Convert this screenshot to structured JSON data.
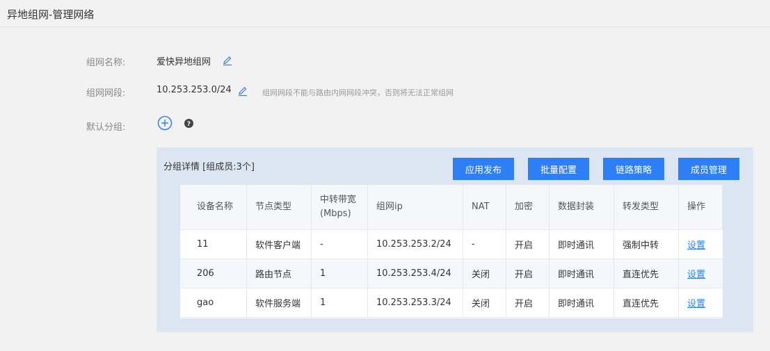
{
  "header": {
    "title": "异地组网-管理网络"
  },
  "form": {
    "name_label": "组网名称:",
    "name_value": "爱快异地组网",
    "segment_label": "组网网段:",
    "segment_value": "10.253.253.0/24",
    "segment_hint": "组网网段不能与路由内网网段冲突，否则将无法正常组网",
    "group_label": "默认分组:"
  },
  "panel": {
    "title": "分组详情 [组成员:3个]",
    "buttons": [
      "应用发布",
      "批量配置",
      "链路策略",
      "成员管理"
    ]
  },
  "table": {
    "headers": [
      "设备名称",
      "节点类型",
      "中转带宽",
      "(Mbps)",
      "组网ip",
      "NAT",
      "加密",
      "数据封装",
      "转发类型",
      "操作"
    ],
    "rows": [
      [
        "11",
        "软件客户端",
        "-",
        "10.253.253.2/24",
        "-",
        "开启",
        "即时通讯",
        "强制中转",
        "设置"
      ],
      [
        "206",
        "路由节点",
        "1",
        "10.253.253.4/24",
        "关闭",
        "开启",
        "即时通讯",
        "直连优先",
        "设置"
      ],
      [
        "gao",
        "软件服务端",
        "1",
        "10.253.253.3/24",
        "关闭",
        "开启",
        "即时通讯",
        "直连优先",
        "设置"
      ]
    ]
  },
  "icons": {
    "edit": "pencil-icon",
    "add": "plus-circle-icon",
    "help": "question-circle-icon"
  },
  "colors": {
    "accent": "#2e7ff5",
    "panel_bg": "#dce6f2",
    "page_bg": "#f2f2f2"
  }
}
